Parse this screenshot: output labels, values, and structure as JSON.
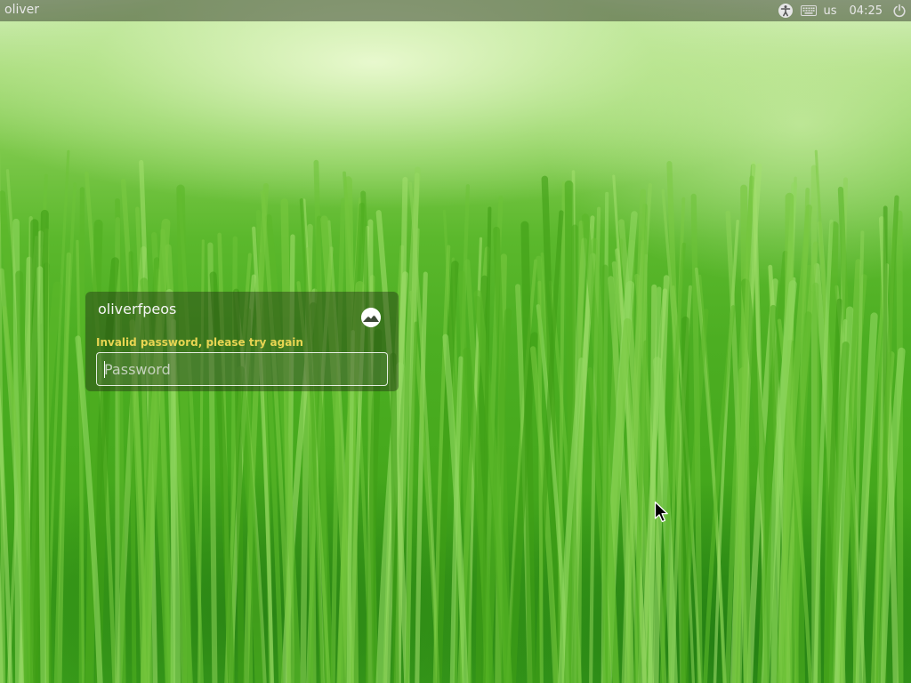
{
  "panel": {
    "hostname": "oliver",
    "keyboard_layout": "us",
    "clock": "04:25",
    "icons": {
      "accessibility": "accessibility-icon",
      "keyboard": "keyboard-icon",
      "power": "power-icon"
    }
  },
  "login": {
    "username": "oliverfpeos",
    "error_message": "Invalid password, please try again",
    "password_placeholder": "Password",
    "password_value": "",
    "session_icon": "session-badge-icon"
  },
  "colors": {
    "error_text": "#e8d552",
    "panel_background": "#3b3b3b",
    "wallpaper_green": "#4cae22"
  }
}
